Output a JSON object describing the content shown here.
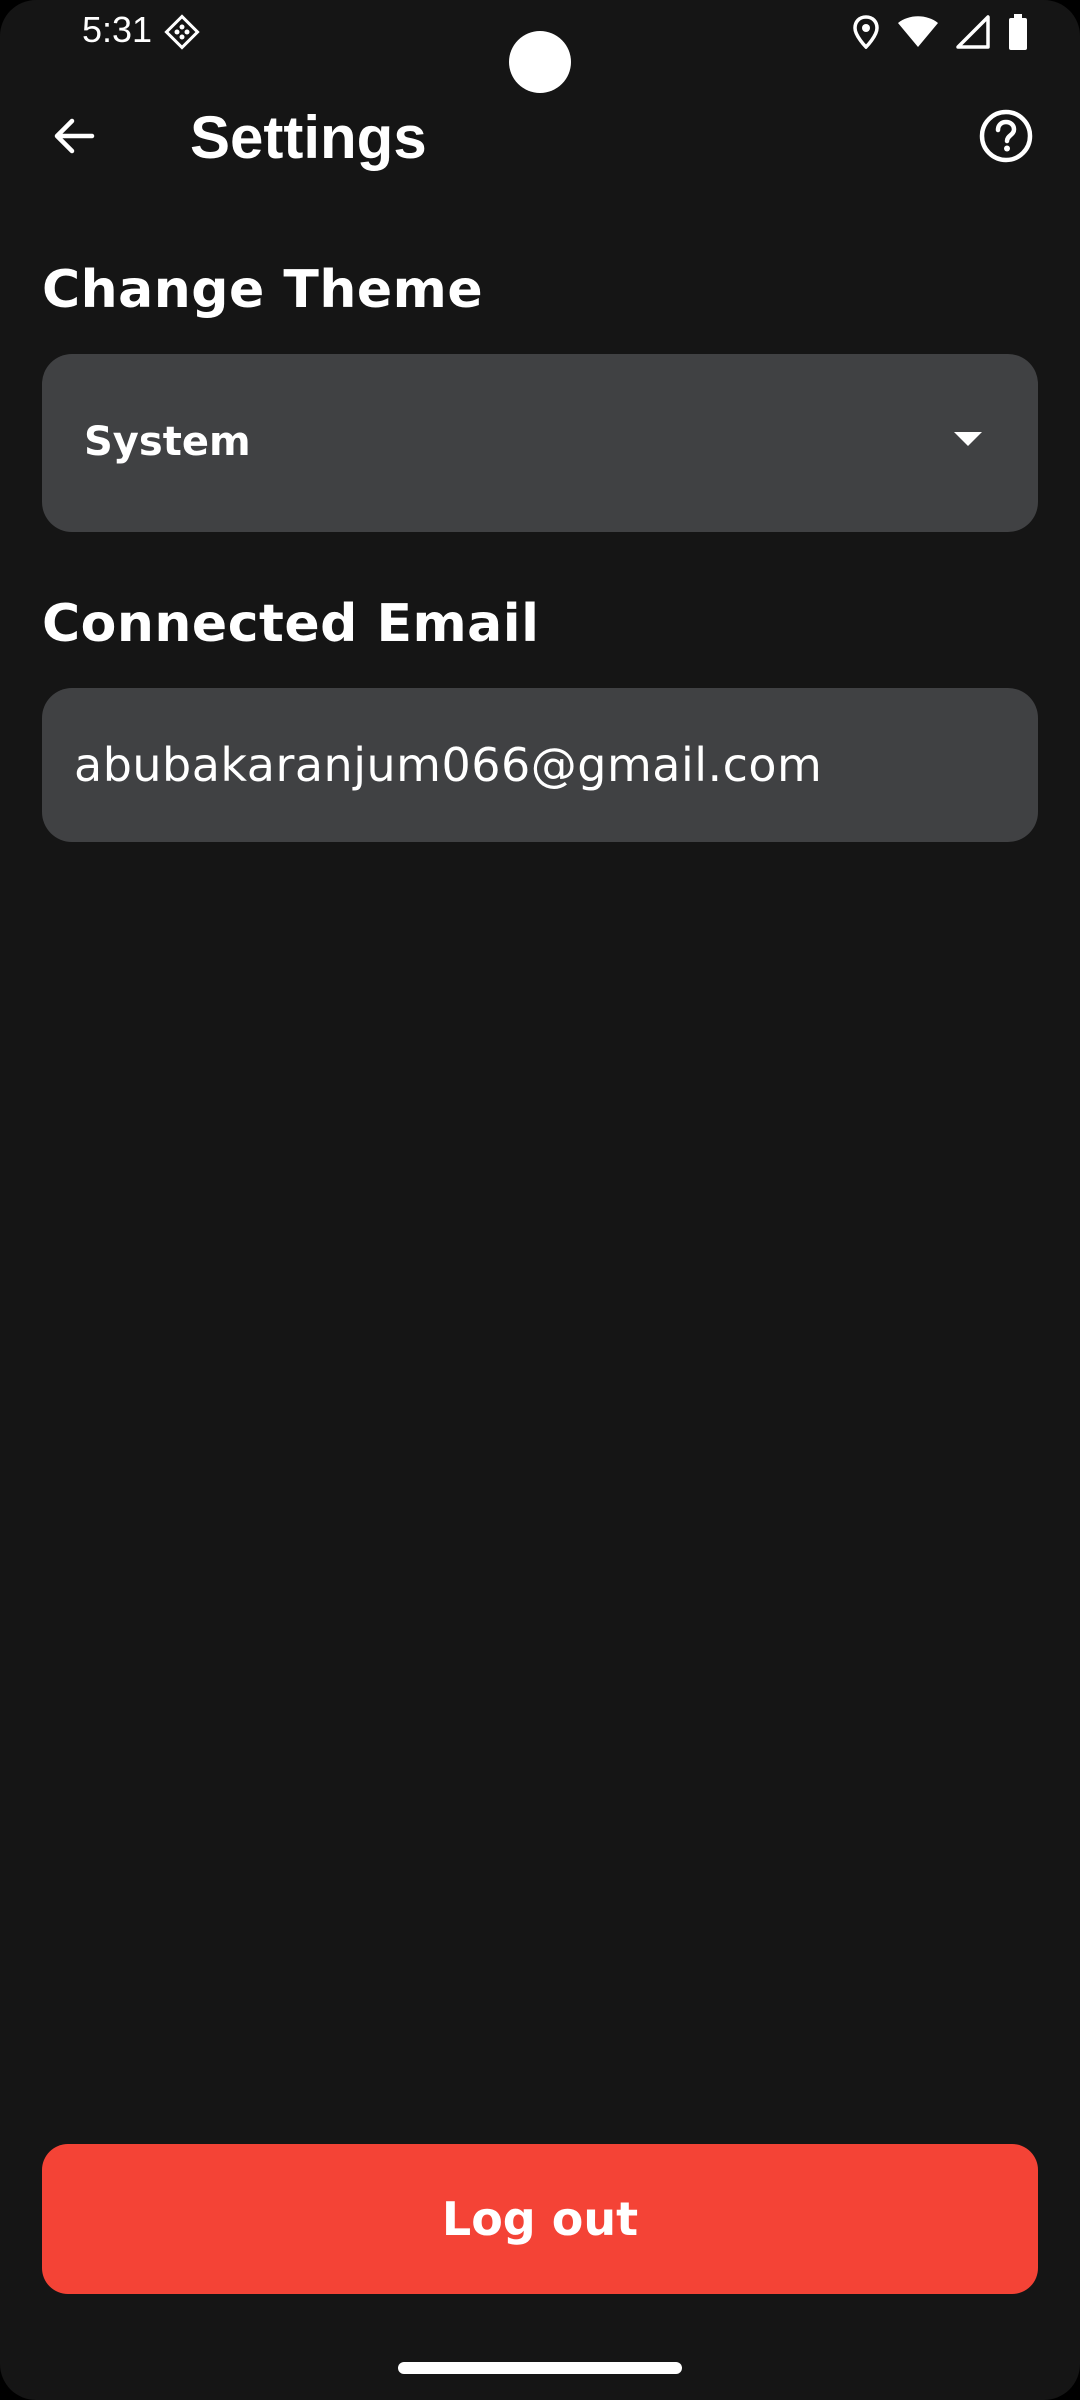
{
  "status_bar": {
    "time": "5:31",
    "left_icon": "app-notification-icon",
    "right_icons": [
      "location-icon",
      "wifi-icon",
      "signal-icon",
      "battery-icon"
    ]
  },
  "app_bar": {
    "title": "Settings",
    "back_icon": "arrow-back-icon",
    "help_icon": "help-circle-icon"
  },
  "theme": {
    "label": "Change Theme",
    "selected": "System"
  },
  "email": {
    "label": "Connected Email",
    "value": "abubakaranjum066@gmail.com"
  },
  "logout": {
    "label": "Log out"
  },
  "colors": {
    "background": "#151515",
    "field": "#404143",
    "accent": "#f44336",
    "text": "#ffffff"
  }
}
